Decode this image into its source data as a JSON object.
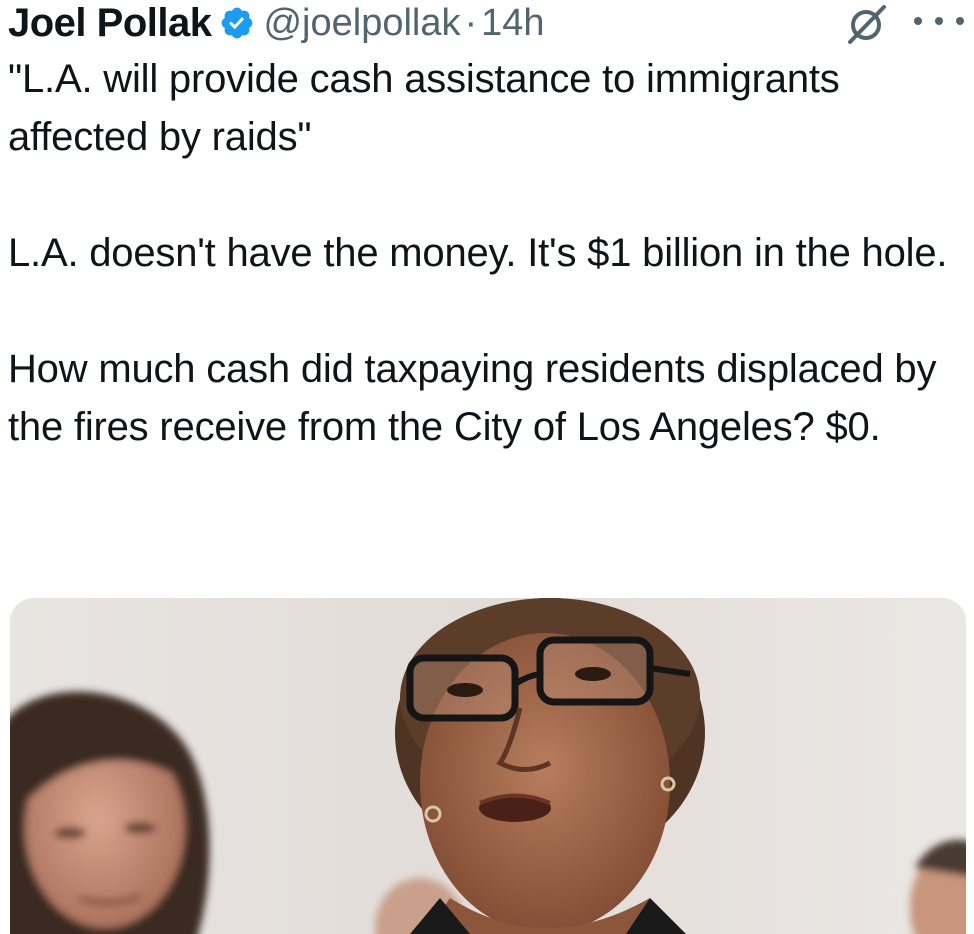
{
  "author": {
    "name": "Joel Pollak",
    "handle": "@joelpollak",
    "separator": "·",
    "time": "14h",
    "verified": true
  },
  "icons": {
    "verified": "verified-badge-icon",
    "grok": "grok-icon",
    "more": "more-options-icon"
  },
  "colors": {
    "verified": "#1d9bf0",
    "text": "#0f1419",
    "secondary": "#536471"
  },
  "tweet": {
    "paragraphs": [
      "\"L.A. will provide cash assistance to immigrants affected by raids\"",
      "L.A. doesn't have the money. It's $1 billion in the hole.",
      "How much cash did taxpaying residents displaced by the fires receive from the City of Los Angeles? $0."
    ]
  }
}
